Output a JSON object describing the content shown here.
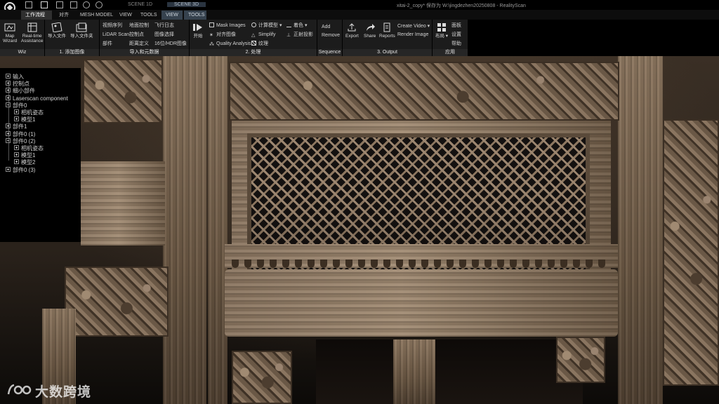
{
  "window": {
    "title": "xitai-2_copy* 保存为 W:\\jingdezhen20250808 - RealityScan",
    "scene_1d": "SCENE 1D",
    "scene_3d": "SCENE 3D"
  },
  "tabs": [
    {
      "label": "工作流程",
      "active": true
    },
    {
      "label": "对齐"
    },
    {
      "label": "MESH MODEL"
    },
    {
      "label": "VIEW"
    },
    {
      "label": "TOOLS"
    },
    {
      "label": "VIEW",
      "alt": true
    },
    {
      "label": "TOOLS",
      "alt": true
    }
  ],
  "ribbon": {
    "wiz": {
      "label": "Wiz",
      "map_wizard": "Map\nWizard",
      "realtime": "Real-time\nAssistance"
    },
    "add_images": {
      "label": "1. 添加图像",
      "import_files": "导入文件",
      "import_folder": "导入文件夹"
    },
    "import_meta": {
      "label": "导入和元数据",
      "video_sequence": "视频序列",
      "ground_control": "地面控制",
      "flight_log": "飞行日志",
      "lidar_scan": "LiDAR Scan",
      "control_points": "控制点",
      "image_selection": "图像选择",
      "component": "部件",
      "distance_def": "距离定义",
      "hdr_images": "16位/HDR图像"
    },
    "process": {
      "label": "2. 处理",
      "start": "开始",
      "mask_images": "Mask Images",
      "compute_model": "计算模型",
      "colorize": "着色",
      "align_images": "对齐图像",
      "simplify": "Simplify",
      "ortho_projection": "正射投影",
      "quality_analysis": "Quality Analysis",
      "texture": "纹理"
    },
    "sequence": {
      "label": "Sequence",
      "add": "Add",
      "remove": "Remove"
    },
    "output": {
      "label": "3. Output",
      "export": "Export",
      "share": "Share",
      "reports": "Reports",
      "create_video": "Create Video",
      "render_image": "Render Image"
    },
    "app": {
      "label": "应用",
      "layout": "布局",
      "panel": "面板",
      "settings": "设置",
      "help": "帮助"
    }
  },
  "tree": [
    {
      "label": "输入",
      "level": 0,
      "expander": "plus"
    },
    {
      "label": "控制点",
      "level": 0,
      "expander": "plus"
    },
    {
      "label": "细小部件",
      "level": 0,
      "expander": "plus"
    },
    {
      "label": "Laserscan component",
      "level": 0,
      "expander": "plus"
    },
    {
      "label": "部件0",
      "level": 0,
      "expander": "minus"
    },
    {
      "label": "相机姿态",
      "level": 1,
      "expander": "plus"
    },
    {
      "label": "模型1",
      "level": 1,
      "expander": "plus"
    },
    {
      "label": "部件1",
      "level": 0,
      "expander": "plus"
    },
    {
      "label": "部件0 (1)",
      "level": 0,
      "expander": "plus"
    },
    {
      "label": "部件0 (2)",
      "level": 0,
      "expander": "minus"
    },
    {
      "label": "相机姿态",
      "level": 1,
      "expander": "plus"
    },
    {
      "label": "模型1",
      "level": 1,
      "expander": "plus"
    },
    {
      "label": "模型2",
      "level": 1,
      "expander": "plus"
    },
    {
      "label": "部件0 (3)",
      "level": 0,
      "expander": "plus"
    }
  ],
  "watermark": {
    "text": "大数跨境"
  },
  "colors": {
    "ribbon_bg": "#1c1c1c",
    "active_tab": "#2f2f2f",
    "scene3d_tab": "#36424e"
  }
}
